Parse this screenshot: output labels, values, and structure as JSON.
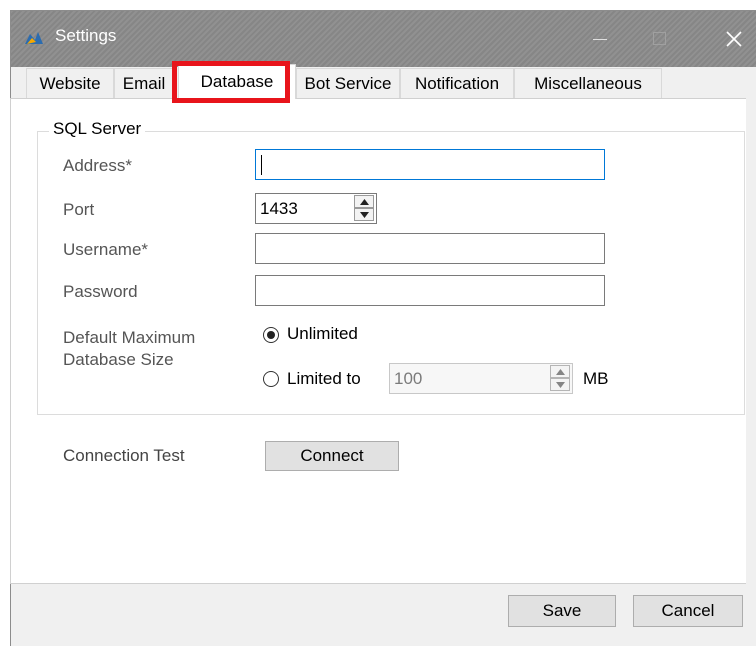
{
  "window": {
    "title": "Settings",
    "app_icon": "settings-app-icon"
  },
  "tabs": [
    {
      "label": "Website"
    },
    {
      "label": "Email"
    },
    {
      "label": "Database",
      "active": true
    },
    {
      "label": "Bot Service"
    },
    {
      "label": "Notification"
    },
    {
      "label": "Miscellaneous"
    }
  ],
  "group": {
    "title": "SQL Server",
    "address_label": "Address*",
    "address_value": "",
    "port_label": "Port",
    "port_value": "1433",
    "username_label": "Username*",
    "username_value": "",
    "password_label": "Password",
    "password_value": "",
    "db_size_label_1": "Default Maximum",
    "db_size_label_2": "Database Size",
    "unlimited_label": "Unlimited",
    "limited_label": "Limited to",
    "limit_value": "100",
    "limit_unit": "MB"
  },
  "connection": {
    "label": "Connection Test",
    "button": "Connect"
  },
  "footer": {
    "save": "Save",
    "cancel": "Cancel"
  },
  "colors": {
    "highlight": "#e8141b",
    "focus_border": "#0078d7",
    "titlebar": "#8a8a8a"
  }
}
